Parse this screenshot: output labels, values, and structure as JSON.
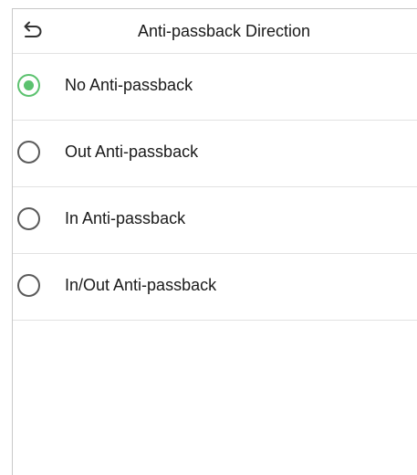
{
  "header": {
    "title": "Anti-passback Direction",
    "back_icon": "back-arrow-icon"
  },
  "options": [
    {
      "label": "No Anti-passback",
      "checked": true
    },
    {
      "label": "Out Anti-passback",
      "checked": false
    },
    {
      "label": "In Anti-passback",
      "checked": false
    },
    {
      "label": "In/Out Anti-passback",
      "checked": false
    }
  ],
  "colors": {
    "accent": "#5cc26f",
    "radio_border": "#5a5a5a",
    "divider": "#e2e2e2",
    "text": "#1a1a1a"
  }
}
